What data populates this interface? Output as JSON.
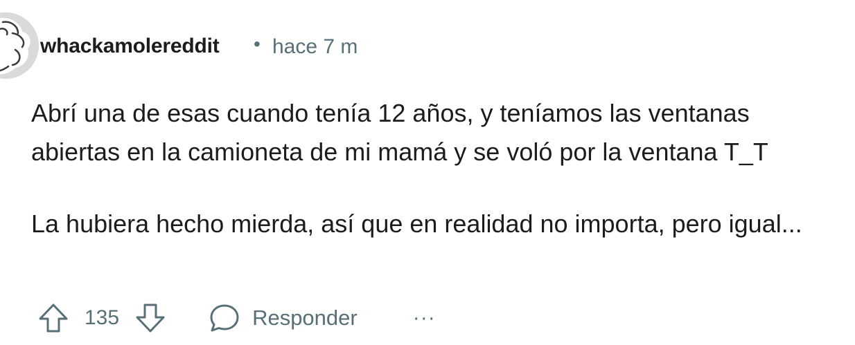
{
  "comment": {
    "author": "whackamolereddit",
    "separator": "•",
    "timestamp": "hace 7 m",
    "paragraphs": [
      "Abrí una de esas cuando tenía 12 años, y teníamos las ventanas abiertas en la camioneta de mi mamá y se voló por la ventana T_T",
      "La hubiera hecho mierda, así que en realidad no importa, pero igual..."
    ]
  },
  "actions": {
    "upvote_icon": "arrow-up-icon",
    "score": "135",
    "downvote_icon": "arrow-down-icon",
    "reply_icon": "speech-bubble-icon",
    "reply_label": "Responder",
    "more_label": "···"
  },
  "colors": {
    "text": "#1c1c1c",
    "meta": "#576f76",
    "avatar_bg": "#d9dadc"
  }
}
